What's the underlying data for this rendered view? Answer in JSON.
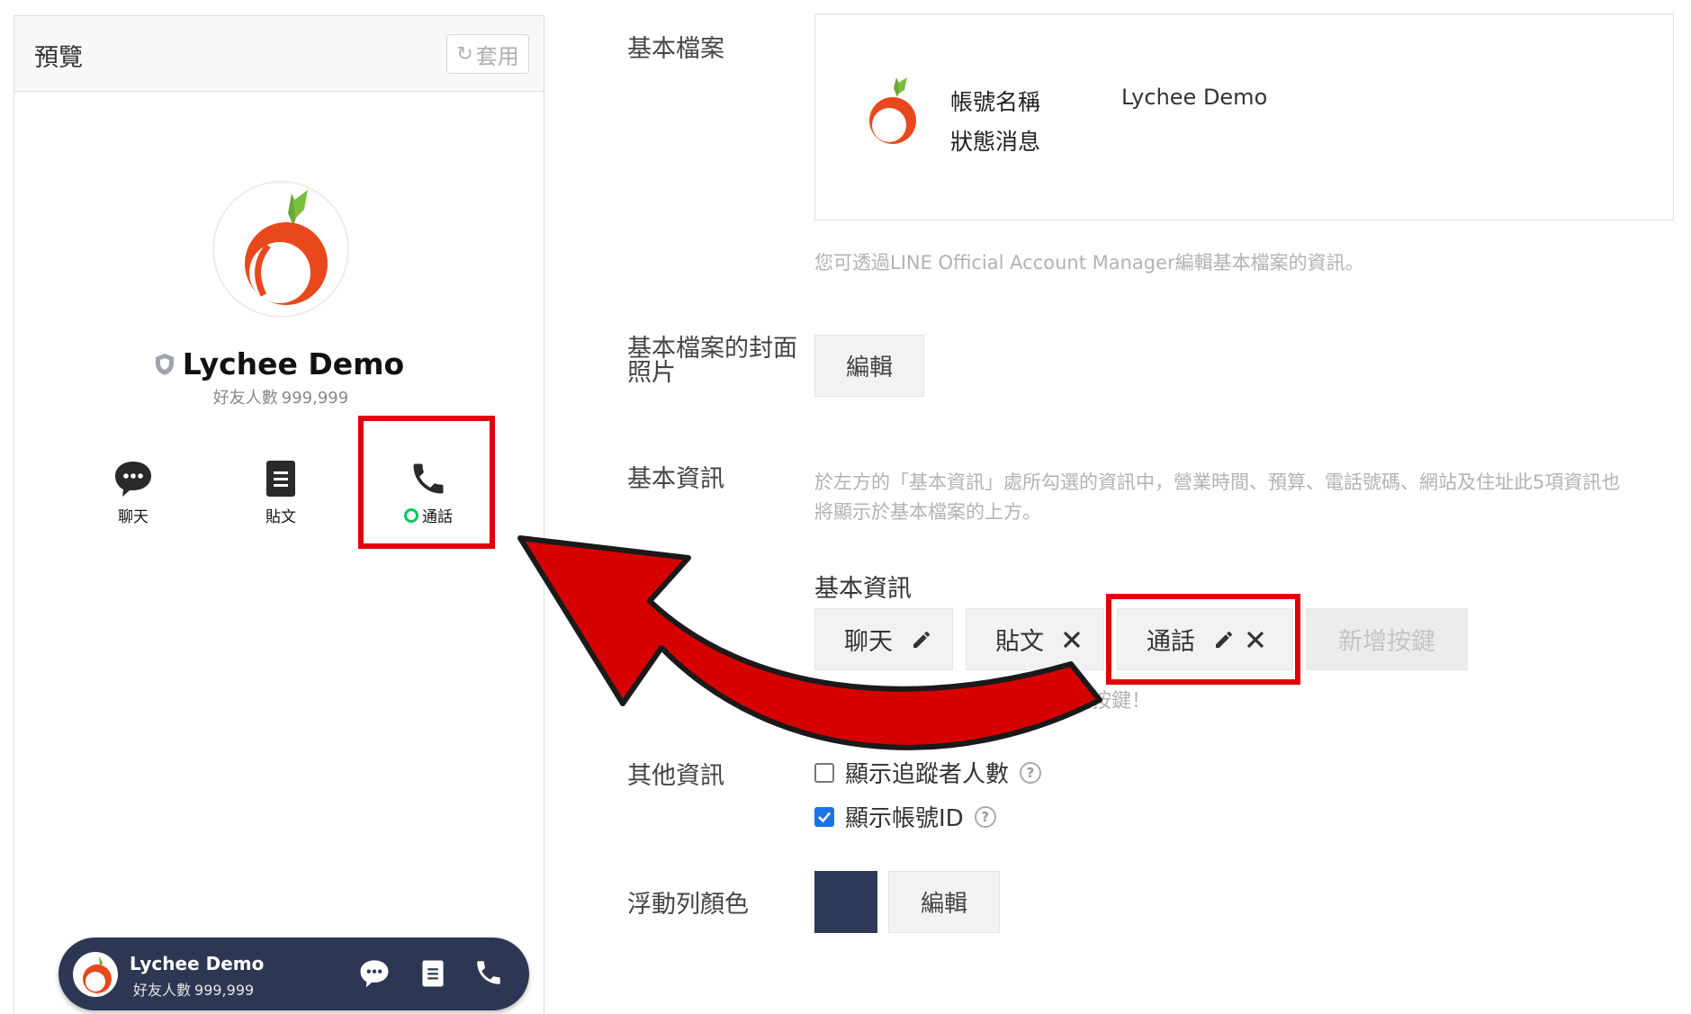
{
  "preview": {
    "title": "預覽",
    "apply_button": "套用",
    "profile": {
      "name": "Lychee Demo",
      "friends_label": "好友人數",
      "friends_count": "999,999"
    },
    "actions": [
      {
        "label": "聊天",
        "icon": "chat-bubble-icon"
      },
      {
        "label": "貼文",
        "icon": "post-document-icon"
      },
      {
        "label": "通話",
        "icon": "phone-icon"
      }
    ],
    "floating_bar": {
      "name": "Lychee Demo",
      "friends_label": "好友人數",
      "friends_count": "999,999"
    }
  },
  "settings": {
    "basic_profile": {
      "label": "基本檔案",
      "account_name_label": "帳號名稱",
      "status_message_label": "狀態消息",
      "account_name_value": "Lychee Demo",
      "hint": "您可透過LINE Official Account Manager編輯基本檔案的資訊。"
    },
    "cover_photo": {
      "label_line1": "基本檔案的封面",
      "label_line2": "照片",
      "edit_button": "編輯"
    },
    "basic_info": {
      "label": "基本資訊",
      "hint_line1": "於左方的「基本資訊」處所勾選的資訊中，營業時間、預算、電話號碼、網站及住址此5項資訊也",
      "hint_line2": "將顯示於基本檔案的上方。",
      "buttons_title": "基本資訊",
      "chips": [
        "聊天",
        "貼文",
        "通話"
      ],
      "add_button": "新增按鍵",
      "buttons_hint": "…本檔案」上最多只能設定…個按鍵！"
    },
    "other_info": {
      "label": "其他資訊",
      "show_followers": "顯示追蹤者人數",
      "show_followers_checked": false,
      "show_account_id": "顯示帳號ID",
      "show_account_id_checked": true
    },
    "floating_bar_color": {
      "label": "浮動列顏色",
      "color": "#2e3a57",
      "edit_button": "編輯"
    }
  },
  "colors": {
    "highlight": "#e0000b",
    "arrow": "#d60000",
    "floating_bar": "#2d3753",
    "call_status_dot": "#06c755"
  }
}
